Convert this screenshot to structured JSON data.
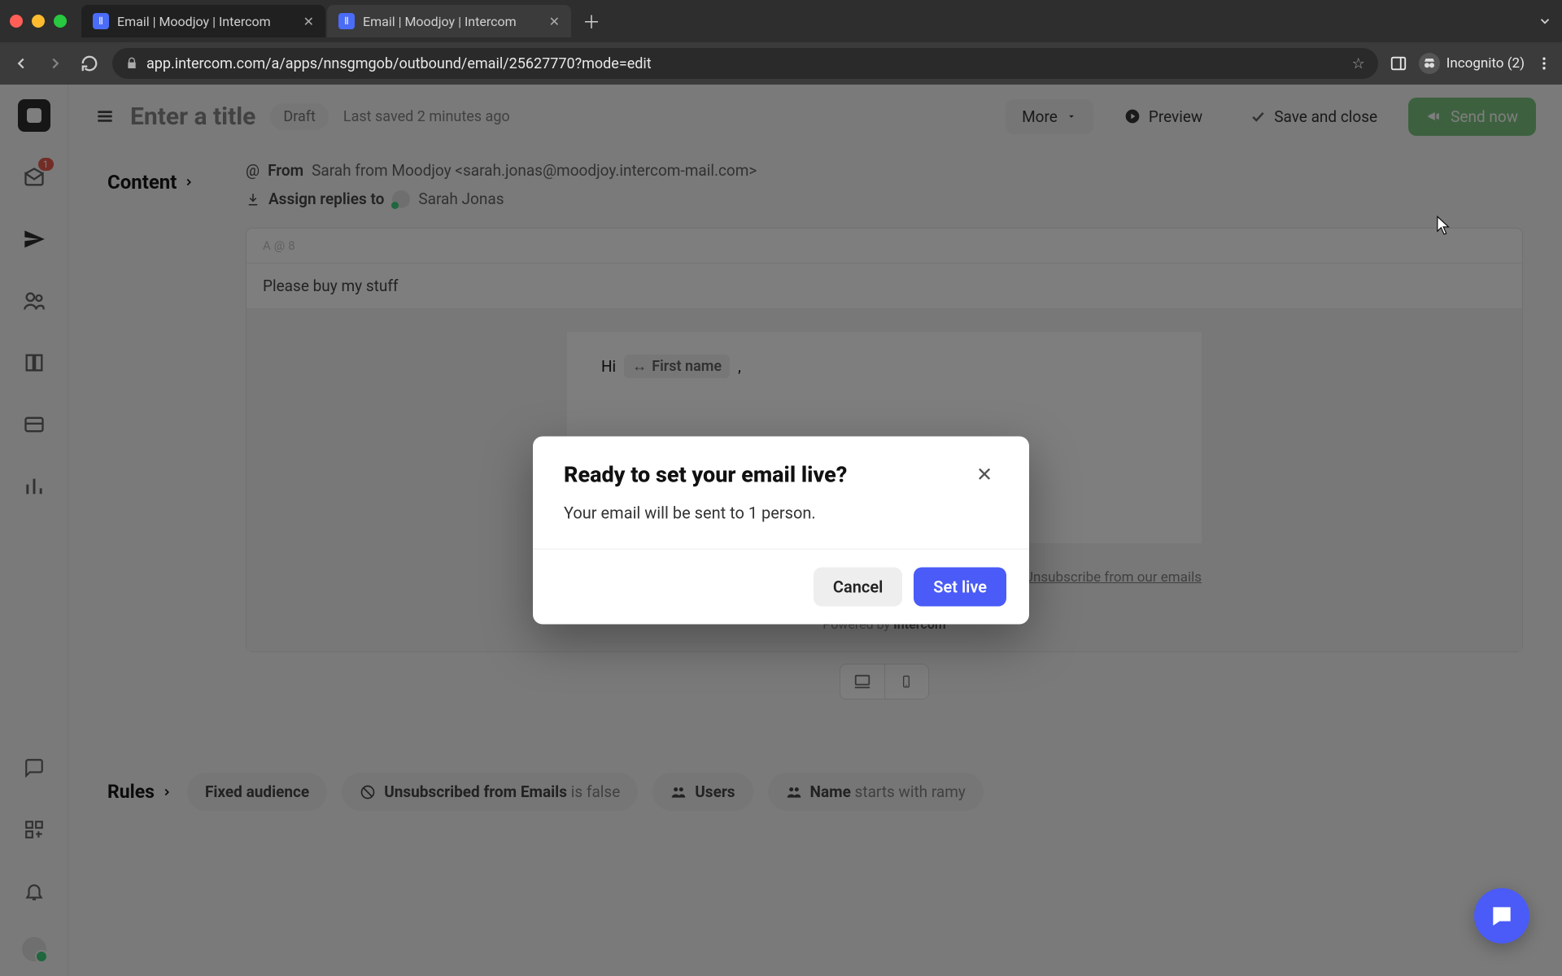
{
  "browser": {
    "tabs": [
      {
        "title": "Email | Moodjoy | Intercom",
        "active": false
      },
      {
        "title": "Email | Moodjoy | Intercom",
        "active": true
      }
    ],
    "url": "app.intercom.com/a/apps/nnsgmgob/outbound/email/25627770?mode=edit",
    "incognito_label": "Incognito (2)"
  },
  "rail": {
    "inbox_badge": "1"
  },
  "topbar": {
    "title_placeholder": "Enter a title",
    "status": "Draft",
    "saved_text": "Last saved 2 minutes ago",
    "more": "More",
    "preview": "Preview",
    "save_close": "Save and close",
    "send_now": "Send now"
  },
  "content": {
    "section": "Content",
    "from_label": "From",
    "from_value": "Sarah from Moodjoy <sarah.jonas@moodjoy.intercom-mail.com>",
    "assign_label": "Assign replies to",
    "assign_value": "Sarah Jonas",
    "dot1": "A",
    "dot2": "@",
    "dot3": "8",
    "subject": "Please buy my stuff",
    "greeting": "Hi",
    "variable_chip": "First name",
    "sender_name": "Sarah from Moodjoy",
    "unsubscribe": "Unsubscribe from our emails",
    "powered_prefix": "Powered by ",
    "powered_brand": "Intercom"
  },
  "rules": {
    "section": "Rules",
    "fixed": "Fixed audience",
    "unsub_bold": "Unsubscribed from Emails",
    "unsub_rest": " is false",
    "users": "Users",
    "name_bold": "Name",
    "name_rest": " starts with ramy"
  },
  "modal": {
    "title": "Ready to set your email live?",
    "body": "Your email will be sent to 1 person.",
    "cancel": "Cancel",
    "confirm": "Set live"
  }
}
